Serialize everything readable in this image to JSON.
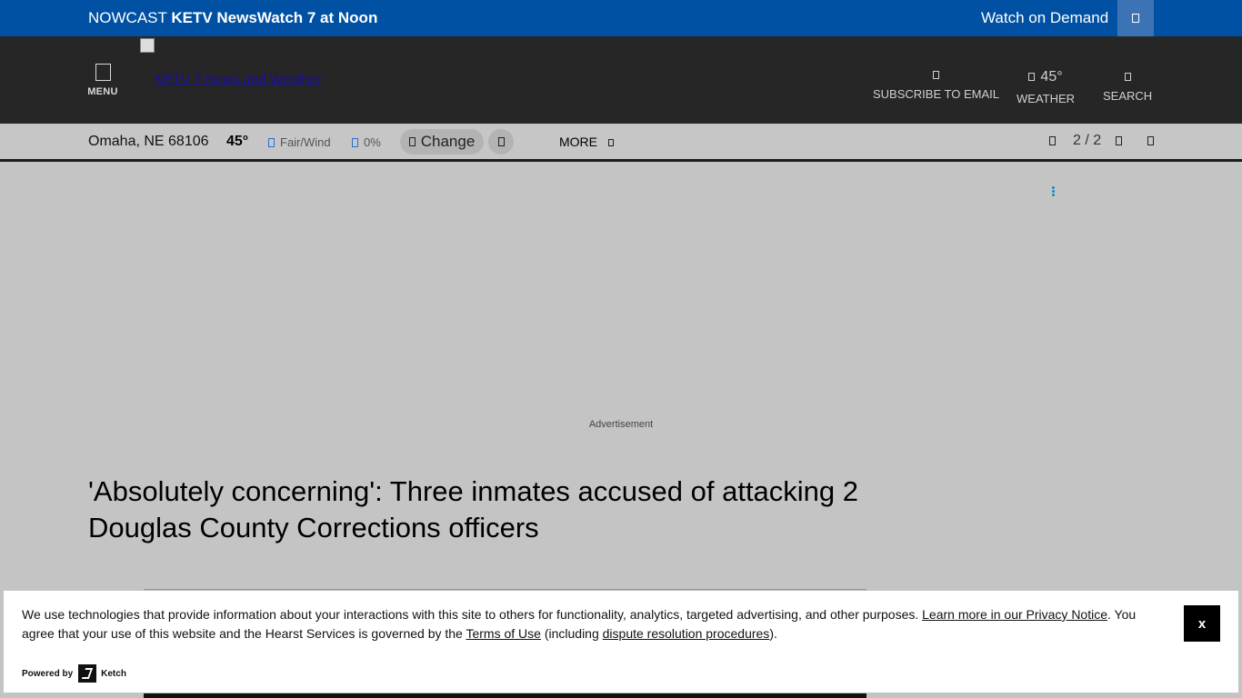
{
  "topbar": {
    "live_prefix": "NOWCAST",
    "live_title": "KETV NewsWatch 7 at Noon",
    "watch_on_demand": "Watch on Demand",
    "play_icon": "play-icon"
  },
  "header": {
    "menu_label": "MENU",
    "logo_link_text": "KETV 7 News and Weather",
    "subscribe_label": "SUBSCRIBE TO EMAIL",
    "weather_temp": "45°",
    "weather_label": "WEATHER",
    "search_label": "SEARCH"
  },
  "weather_strip": {
    "location": "Omaha, NE 68106",
    "temperature": "45°",
    "condition": "Fair/Wind",
    "precip": "0%",
    "change_label": "Change",
    "more_label": "MORE",
    "pager": "2 / 2"
  },
  "ad": {
    "label": "Advertisement"
  },
  "article": {
    "headline": "'Absolutely concerning': Three inmates accused of attacking 2 Douglas County Corrections officers"
  },
  "cookie_banner": {
    "text_1": "We use technologies that provide information about your interactions with this site to others for functionality, analytics, targeted advertising, and other purposes. ",
    "privacy_link": "Learn more in our Privacy Notice",
    "text_2": ". You agree that your use of this website and the Hearst Services is governed by the ",
    "terms_link": "Terms of Use",
    "text_3": " (including ",
    "dispute_link": "dispute resolution procedures",
    "text_4": ").",
    "close_label": "x",
    "powered_by": "Powered by",
    "brand": "Ketch"
  },
  "colors": {
    "topbar": "#0051a4",
    "header": "#262626",
    "page_bg": "#c4c4c4"
  }
}
